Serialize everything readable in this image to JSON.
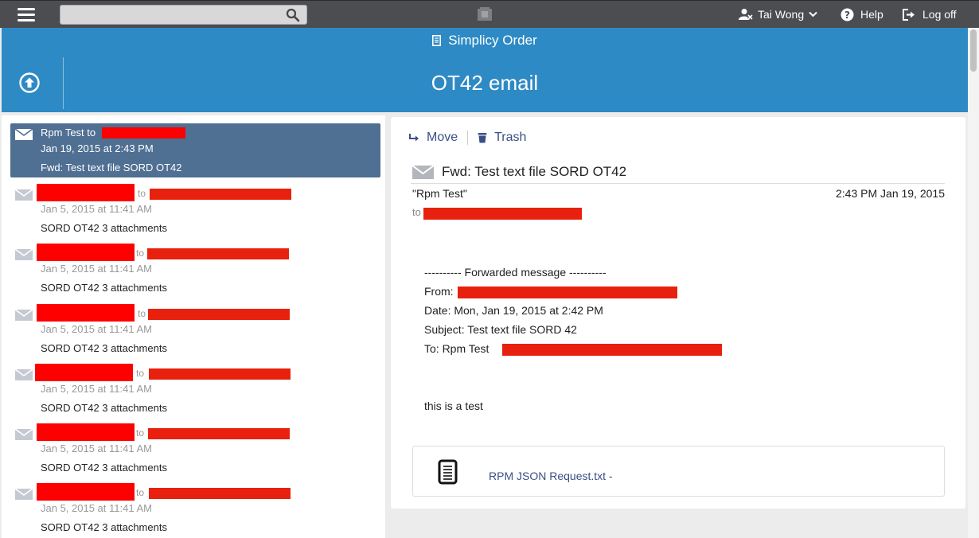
{
  "topbar": {
    "search_placeholder": "",
    "user_name": "Tai Wong",
    "help_label": "Help",
    "logoff_label": "Log off"
  },
  "header": {
    "app_name": "Simplicy Order",
    "page_title": "OT42 email"
  },
  "colors": {
    "header_blue": "#2e8ac4",
    "selected_row": "#4f6f93",
    "link_blue": "#3a4f86",
    "redaction": "#e8200e"
  },
  "messages": [
    {
      "from": "Rpm Test to",
      "to_label": "",
      "date": "Jan 19, 2015 at 2:43 PM",
      "subject": "Fwd: Test text file SORD OT42",
      "selected": true
    },
    {
      "from": "",
      "to_label": "to",
      "date": "Jan 5, 2015 at 11:41 AM",
      "subject": "SORD OT42 3 attachments",
      "selected": false
    },
    {
      "from": "",
      "to_label": "to",
      "date": "Jan 5, 2015 at 11:41 AM",
      "subject": "SORD OT42 3 attachments",
      "selected": false
    },
    {
      "from": "",
      "to_label": "to",
      "date": "Jan 5, 2015 at 11:41 AM",
      "subject": "SORD OT42 3 attachments",
      "selected": false
    },
    {
      "from": "",
      "to_label": "to",
      "date": "Jan 5, 2015 at 11:41 AM",
      "subject": "SORD OT42 3 attachments",
      "selected": false
    },
    {
      "from": "",
      "to_label": "to",
      "date": "Jan 5, 2015 at 11:41 AM",
      "subject": "SORD OT42 3 attachments",
      "selected": false
    },
    {
      "from": "",
      "to_label": "to",
      "date": "Jan 5, 2015 at 11:41 AM",
      "subject": "SORD OT42 3 attachments",
      "selected": false
    }
  ],
  "reader": {
    "move_label": "Move",
    "trash_label": "Trash",
    "subject": "Fwd: Test text file SORD OT42",
    "sender": "\"Rpm Test\"",
    "sent_time": "2:43 PM Jan 19, 2015",
    "to_label": "to",
    "body": {
      "forward_header": "---------- Forwarded message ----------",
      "from_label": "From:",
      "date_line": "Date: Mon, Jan 19, 2015 at 2:42 PM",
      "subject_line": "Subject: Test text file SORD 42",
      "to_line": "To: Rpm Test",
      "text": "this is a test"
    },
    "attachment": {
      "file_name": "RPM JSON Request.txt -",
      "icon": "document-icon"
    }
  }
}
